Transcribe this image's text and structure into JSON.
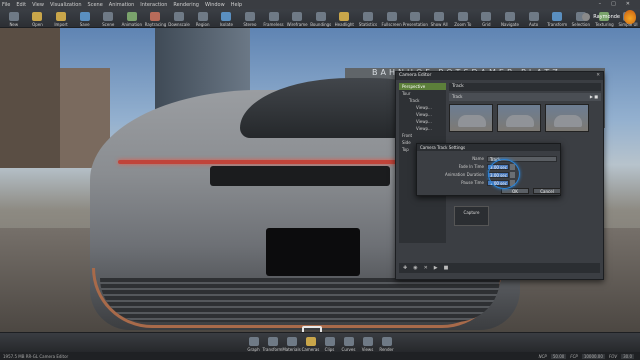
{
  "menubar": [
    "File",
    "Edit",
    "View",
    "Visualization",
    "Scene",
    "Animation",
    "Interaction",
    "Rendering",
    "Window",
    "Help"
  ],
  "toolbar": [
    "New",
    "Open",
    "Import",
    "Save",
    "Scene",
    "Animation",
    "Raytracing",
    "Downscale",
    "Region",
    "Isolate",
    "Stereo",
    "Frameless",
    "Wireframe",
    "Boundings",
    "Headlight",
    "Statistics",
    "Fullscreen",
    "Presentation",
    "Show All",
    "Zoom To",
    "Grid",
    "Navigate",
    "Auto",
    "Transform",
    "Selection",
    "Texturing",
    "Simple UI"
  ],
  "user": {
    "name": "Raymonde"
  },
  "scene": {
    "station_sign": "BAHNHOF POTSDAMER PLATZ"
  },
  "camera_editor": {
    "title": "Camera Editor",
    "close": "✕",
    "tree": [
      {
        "label": "Perspective",
        "cls": "sel"
      },
      {
        "label": "Tour",
        "cls": ""
      },
      {
        "label": "Track",
        "cls": "sub"
      },
      {
        "label": "Viewp...",
        "cls": "sub2"
      },
      {
        "label": "Viewp...",
        "cls": "sub2"
      },
      {
        "label": "Viewp...",
        "cls": "sub2"
      },
      {
        "label": "Viewp...",
        "cls": "sub2"
      },
      {
        "label": "Front",
        "cls": ""
      },
      {
        "label": "Side",
        "cls": ""
      },
      {
        "label": "Top",
        "cls": ""
      }
    ],
    "section": "Track",
    "track_row": "Track",
    "capture": "Capture"
  },
  "track_settings": {
    "title": "Camera Track Settings",
    "fields": [
      {
        "label": "Name",
        "value": "Track"
      },
      {
        "label": "Fade In Time",
        "value": "3.00 sec"
      },
      {
        "label": "Animation Duration",
        "value": "3.00 sec"
      },
      {
        "label": "Pause Time",
        "value": "1.00 sec"
      }
    ],
    "ok": "OK",
    "cancel": "Cancel"
  },
  "dock": [
    "Graph",
    "Transform",
    "Materials",
    "Cameras",
    "Clips",
    "Curves",
    "Views",
    "Render"
  ],
  "status": {
    "memory": "1957.5 MB",
    "mode": "RR-GL",
    "editor": "Camera Editor",
    "ncp_label": "NCP",
    "ncp": "50.00",
    "fcp_label": "FCP",
    "fcp": "10000.00",
    "fov_label": "FOV",
    "fov": "30.0"
  }
}
